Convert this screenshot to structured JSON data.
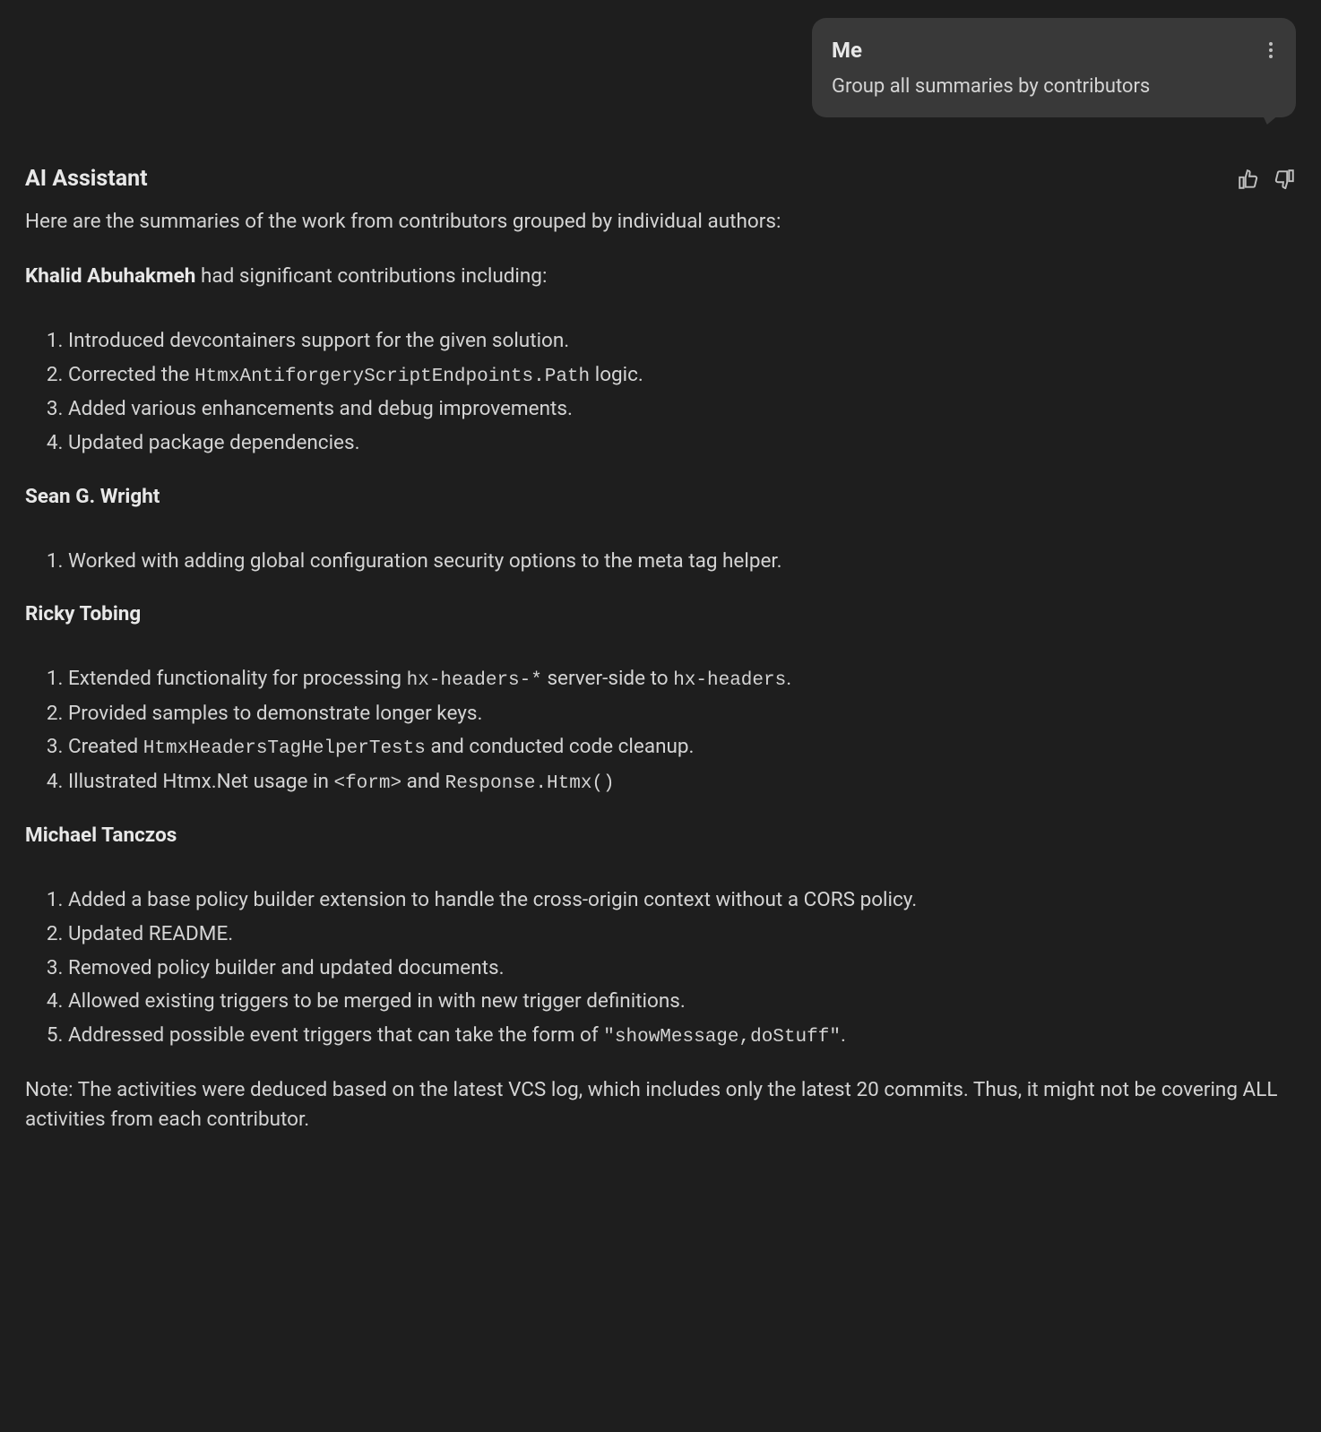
{
  "user": {
    "name": "Me",
    "message": "Group all summaries by contributors"
  },
  "assistant": {
    "name": "AI Assistant",
    "intro": "Here are the summaries of the work from contributors grouped by individual authors:",
    "contributor1": {
      "name": "Khalid Abuhakmeh",
      "suffix": " had significant contributions including:",
      "item1": "Introduced devcontainers support for the given solution.",
      "item2_pre": "Corrected the ",
      "item2_code": "HtmxAntiforgeryScriptEndpoints.Path",
      "item2_post": " logic.",
      "item3": "Added various enhancements and debug improvements.",
      "item4": "Updated package dependencies."
    },
    "contributor2": {
      "name": "Sean G. Wright",
      "item1": "Worked with adding global configuration security options to the meta tag helper."
    },
    "contributor3": {
      "name": "Ricky Tobing",
      "item1_pre": "Extended functionality for processing ",
      "item1_code1": "hx-headers-*",
      "item1_mid": " server-side to ",
      "item1_code2": "hx-headers",
      "item1_post": ".",
      "item2": "Provided samples to demonstrate longer keys.",
      "item3_pre": "Created ",
      "item3_code": "HtmxHeadersTagHelperTests",
      "item3_post": " and conducted code cleanup.",
      "item4_pre": "Illustrated Htmx.Net usage in ",
      "item4_code1": "<form>",
      "item4_mid": " and ",
      "item4_code2": "Response.Htmx()"
    },
    "contributor4": {
      "name": "Michael Tanczos",
      "item1": "Added a base policy builder extension to handle the cross-origin context without a CORS policy.",
      "item2": "Updated README.",
      "item3": "Removed policy builder and updated documents.",
      "item4": "Allowed existing triggers to be merged in with new trigger definitions.",
      "item5_pre": "Addressed possible event triggers that can take the form of ",
      "item5_code": "\"showMessage,doStuff\"",
      "item5_post": "."
    },
    "note": "Note: The activities were deduced based on the latest VCS log, which includes only the latest 20 commits. Thus, it might not be covering ALL activities from each contributor."
  }
}
